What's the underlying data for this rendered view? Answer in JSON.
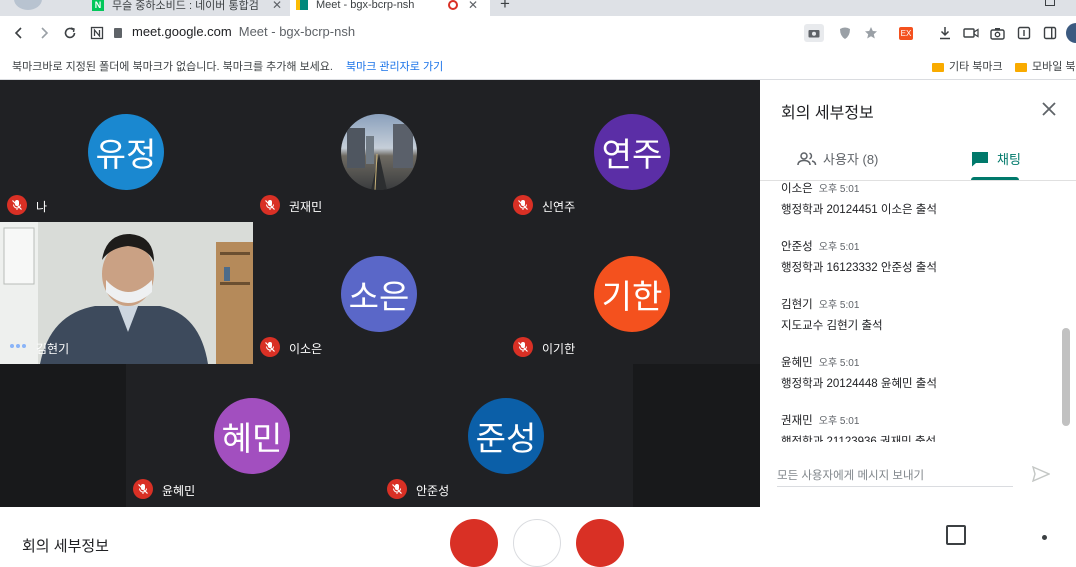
{
  "browser": {
    "tabs": [
      {
        "title": "무슬 중하소비드 : 네이버 통합검",
        "active": false
      },
      {
        "title": "Meet - bgx-bcrp-nsh",
        "active": true
      }
    ],
    "new_tab": "+",
    "close": "✕",
    "url_domain": "meet.google.com",
    "url_title": "Meet - bgx-bcrp-nsh",
    "bookmark_bar_message": "북마크바로 지정된 폴더에 북마크가 없습니다. 북마크를 추가해 보세요.",
    "bookmark_manager_link": "북마크 관리자로 가기",
    "bookmark_folders": [
      "기타 북마크",
      "모바일 북"
    ],
    "extension_badge": "EX"
  },
  "participants": [
    {
      "name": "나",
      "initials": "유정",
      "color": "#1a88d0",
      "muted": true
    },
    {
      "name": "권재민",
      "initials": "",
      "color": "#6a7a8a",
      "muted": true,
      "photo": true
    },
    {
      "name": "신연주",
      "initials": "연주",
      "color": "#5b2ea6",
      "muted": true
    },
    {
      "name": "김현기",
      "initials": "",
      "muted": false,
      "video": true
    },
    {
      "name": "이소은",
      "initials": "소은",
      "color": "#5a67c8",
      "muted": true
    },
    {
      "name": "이기한",
      "initials": "기한",
      "color": "#f4511e",
      "muted": true
    },
    {
      "name": "윤혜민",
      "initials": "혜민",
      "color": "#a24fbf",
      "muted": true
    },
    {
      "name": "안준성",
      "initials": "준성",
      "color": "#0b5fa8",
      "muted": true
    }
  ],
  "panel": {
    "title": "회의 세부정보",
    "tab_people": "사용자 (8)",
    "tab_chat": "채팅",
    "messages": [
      {
        "sender": "이소은",
        "time": "오후 5:01",
        "text": "행정학과 20124451 이소은 출석"
      },
      {
        "sender": "안준성",
        "time": "오후 5:01",
        "text": "행정학과 16123332 안준성 출석"
      },
      {
        "sender": "김현기",
        "time": "오후 5:01",
        "text": "지도교수 김현기 출석"
      },
      {
        "sender": "윤혜민",
        "time": "오후 5:01",
        "text": "행정학과 20124448 윤혜민 출석"
      },
      {
        "sender": "권재민",
        "time": "오후 5:01",
        "text": "행정학과 21123936 권재민 출석"
      }
    ],
    "input_placeholder": "모든 사용자에게 메시지 보내기"
  },
  "bottom": {
    "meeting_details": "회의 세부정보"
  },
  "colors": {
    "accent": "#00796b",
    "meet_bg": "#202124",
    "mute_red": "#d93025"
  }
}
